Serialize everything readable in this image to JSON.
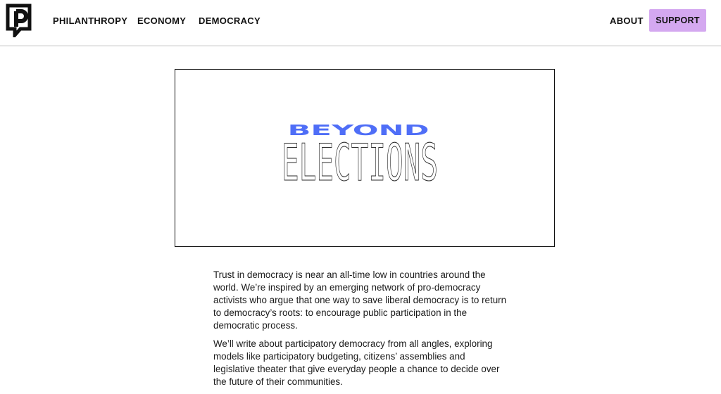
{
  "header": {
    "logo_icon": "p-speech-bubble-logo-icon",
    "nav": [
      {
        "label": "PHILANTHROPY"
      },
      {
        "label": "ECONOMY"
      },
      {
        "label": "DEMOCRACY"
      }
    ],
    "about_label": "ABOUT",
    "support_label": "SUPPORT"
  },
  "hero": {
    "line1": "BEYOND",
    "line2": "ELECTIONS"
  },
  "article": {
    "paragraphs": [
      "Trust in democracy is near an all-time low in countries around the world. We’re inspired by an emerging network of pro-democracy activists who argue that one way to save liberal democracy is to return to democracy’s roots: to encourage public participation in the democratic process.",
      "We’ll write about participatory democracy from all angles, exploring models like participatory budgeting, citizens’ assemblies and legislative theater that give everyday people a chance to decide over the future of their communities."
    ]
  },
  "colors": {
    "support_bg": "#d4a8f0",
    "beyond_blue": "#4f6ef7",
    "text": "#1a1a1a"
  }
}
